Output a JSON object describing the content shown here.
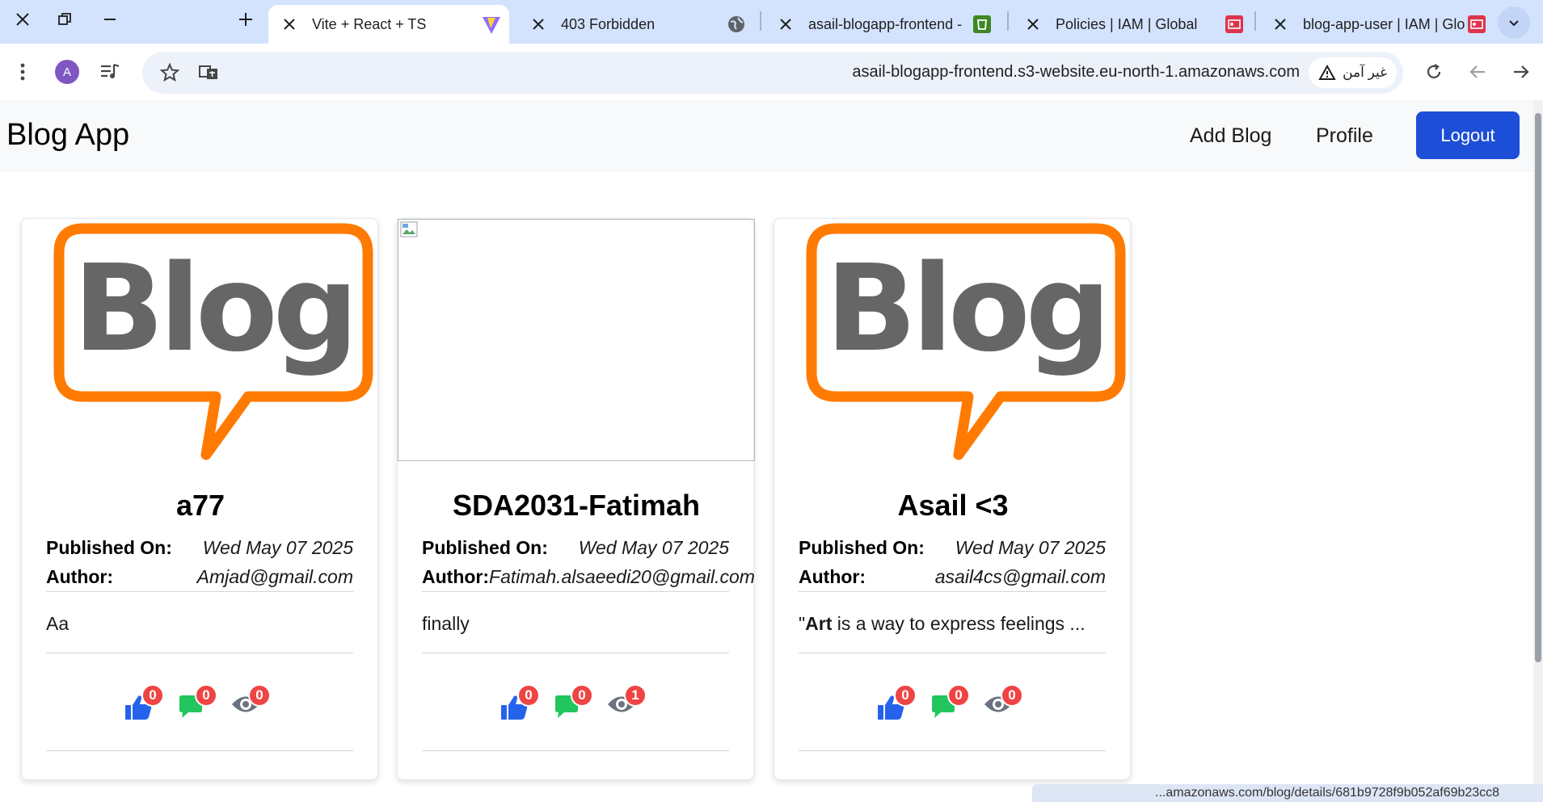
{
  "browser": {
    "tabs": [
      {
        "title": "Vite + React + TS",
        "active": true,
        "icon": "vite-icon"
      },
      {
        "title": "403 Forbidden",
        "active": false,
        "icon": "globe-icon"
      },
      {
        "title": "asail-blogapp-frontend -",
        "active": false,
        "icon": "s3-bucket-icon"
      },
      {
        "title": "Policies | IAM | Global",
        "active": false,
        "icon": "iam-icon"
      },
      {
        "title": "blog-app-user | IAM | Glo",
        "active": false,
        "icon": "iam-icon"
      }
    ],
    "profile_initial": "A",
    "url": "asail-blogapp-frontend.s3-website.eu-north-1.amazonaws.com",
    "security_label": "غير آمن",
    "status_url": "...amazonaws.com/blog/details/681b9728f9b052af69b23cc8"
  },
  "app": {
    "brand": "Blog App",
    "nav": {
      "add_blog": "Add Blog",
      "profile": "Profile",
      "logout": "Logout"
    },
    "labels": {
      "published_on": "Published On:",
      "author": "Author:"
    },
    "colors": {
      "primary": "#1d4ed8",
      "like": "#2563eb",
      "comment": "#22c55e",
      "view": "#6b7280",
      "badge": "#ef4444",
      "logo_orange": "#ff7a00",
      "logo_gray": "#666666"
    },
    "blogs": [
      {
        "title": "a77",
        "image": "blog-logo",
        "published_on": "Wed May 07 2025",
        "author": "Amjad@gmail.com",
        "excerpt_bold": "",
        "excerpt": "Aa",
        "likes": "0",
        "comments": "0",
        "views": "0"
      },
      {
        "title": "SDA2031-Fatimah",
        "image": "broken-image",
        "published_on": "Wed May 07 2025",
        "author": "Fatimah.alsaeedi20@gmail.com",
        "excerpt_bold": "",
        "excerpt": "finally",
        "likes": "0",
        "comments": "0",
        "views": "1"
      },
      {
        "title": "Asail <3",
        "image": "blog-logo",
        "published_on": "Wed May 07 2025",
        "author": "asail4cs@gmail.com",
        "excerpt_prefix": "\"",
        "excerpt_bold": "Art",
        "excerpt": " is a way to express feelings ...",
        "likes": "0",
        "comments": "0",
        "views": "0"
      }
    ]
  }
}
